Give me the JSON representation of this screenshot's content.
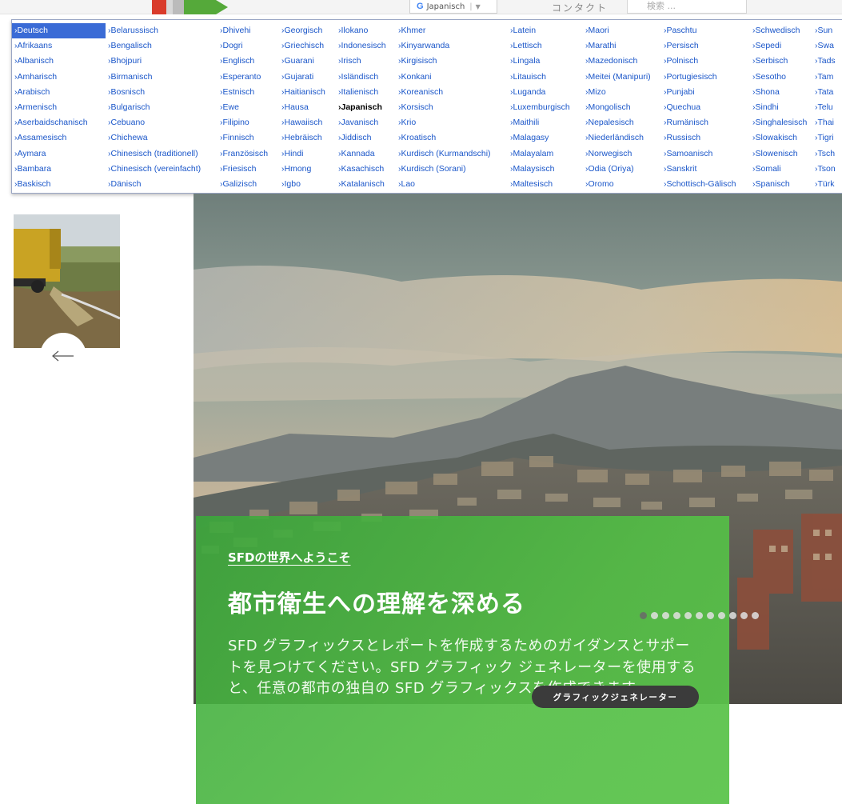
{
  "header": {
    "translate_label": "Japanisch",
    "contact": "コンタクト",
    "search_placeholder": "検索 ..."
  },
  "language_menu": {
    "selected": "Deutsch",
    "current": "Japanisch",
    "columns": [
      [
        "›Deutsch",
        "›Afrikaans",
        "›Albanisch",
        "›Amharisch",
        "›Arabisch",
        "›Armenisch",
        "›Aserbaidschanisch",
        "›Assamesisch",
        "›Aymara",
        "›Bambara",
        "›Baskisch"
      ],
      [
        "›Belarussisch",
        "›Bengalisch",
        "›Bhojpuri",
        "›Birmanisch",
        "›Bosnisch",
        "›Bulgarisch",
        "›Cebuano",
        "›Chichewa",
        "›Chinesisch (traditionell)",
        "›Chinesisch (vereinfacht)",
        "›Dänisch"
      ],
      [
        "›Dhivehi",
        "›Dogri",
        "›Englisch",
        "›Esperanto",
        "›Estnisch",
        "›Ewe",
        "›Filipino",
        "›Finnisch",
        "›Französisch",
        "›Friesisch",
        "›Galizisch"
      ],
      [
        "›Georgisch",
        "›Griechisch",
        "›Guarani",
        "›Gujarati",
        "›Haitianisch",
        "›Hausa",
        "›Hawaiisch",
        "›Hebräisch",
        "›Hindi",
        "›Hmong",
        "›Igbo"
      ],
      [
        "›Ilokano",
        "›Indonesisch",
        "›Irisch",
        "›Isländisch",
        "›Italienisch",
        "›Japanisch",
        "›Javanisch",
        "›Jiddisch",
        "›Kannada",
        "›Kasachisch",
        "›Katalanisch"
      ],
      [
        "›Khmer",
        "›Kinyarwanda",
        "›Kirgisisch",
        "›Konkani",
        "›Koreanisch",
        "›Korsisch",
        "›Krio",
        "›Kroatisch",
        "›Kurdisch (Kurmandschi)",
        "›Kurdisch (Sorani)",
        "›Lao"
      ],
      [
        "›Latein",
        "›Lettisch",
        "›Lingala",
        "›Litauisch",
        "›Luganda",
        "›Luxemburgisch",
        "›Maithili",
        "›Malagasy",
        "›Malayalam",
        "›Malaysisch",
        "›Maltesisch"
      ],
      [
        "›Maori",
        "›Marathi",
        "›Mazedonisch",
        "›Meitei (Manipuri)",
        "›Mizo",
        "›Mongolisch",
        "›Nepalesisch",
        "›Niederländisch",
        "›Norwegisch",
        "›Odia (Oriya)",
        "›Oromo"
      ],
      [
        "›Paschtu",
        "›Persisch",
        "›Polnisch",
        "›Portugiesisch",
        "›Punjabi",
        "›Quechua",
        "›Rumänisch",
        "›Russisch",
        "›Samoanisch",
        "›Sanskrit",
        "›Schottisch-Gälisch"
      ],
      [
        "›Schwedisch",
        "›Sepedi",
        "›Serbisch",
        "›Sesotho",
        "›Shona",
        "›Sindhi",
        "›Singhalesisch",
        "›Slowakisch",
        "›Slowenisch",
        "›Somali",
        "›Spanisch"
      ],
      [
        "›Sun",
        "›Swa",
        "›Tads",
        "›Tam",
        "›Tata",
        "›Telu",
        "›Thai",
        "›Tigri",
        "›Tsch",
        "›Tson",
        "›Türk"
      ]
    ]
  },
  "slider": {
    "kicker": "SFDの世界へようこそ",
    "title": "都市衛生への理解を深める",
    "body": "SFD グラフィックスとレポートを作成するためのガイダンスとサポートを見つけてください。SFD グラフィック ジェネレーターを使用すると、任意の都市の独自の SFD グラフィックスを作成できます。",
    "button": "グラフィックジェネレーター",
    "dot_count": 11,
    "active_dot": 0
  },
  "colors": {
    "menu_selected": "#3a6bd6",
    "link": "#1a56c9",
    "panel_green": "#4db848",
    "button_dark": "#3b3b3b"
  }
}
